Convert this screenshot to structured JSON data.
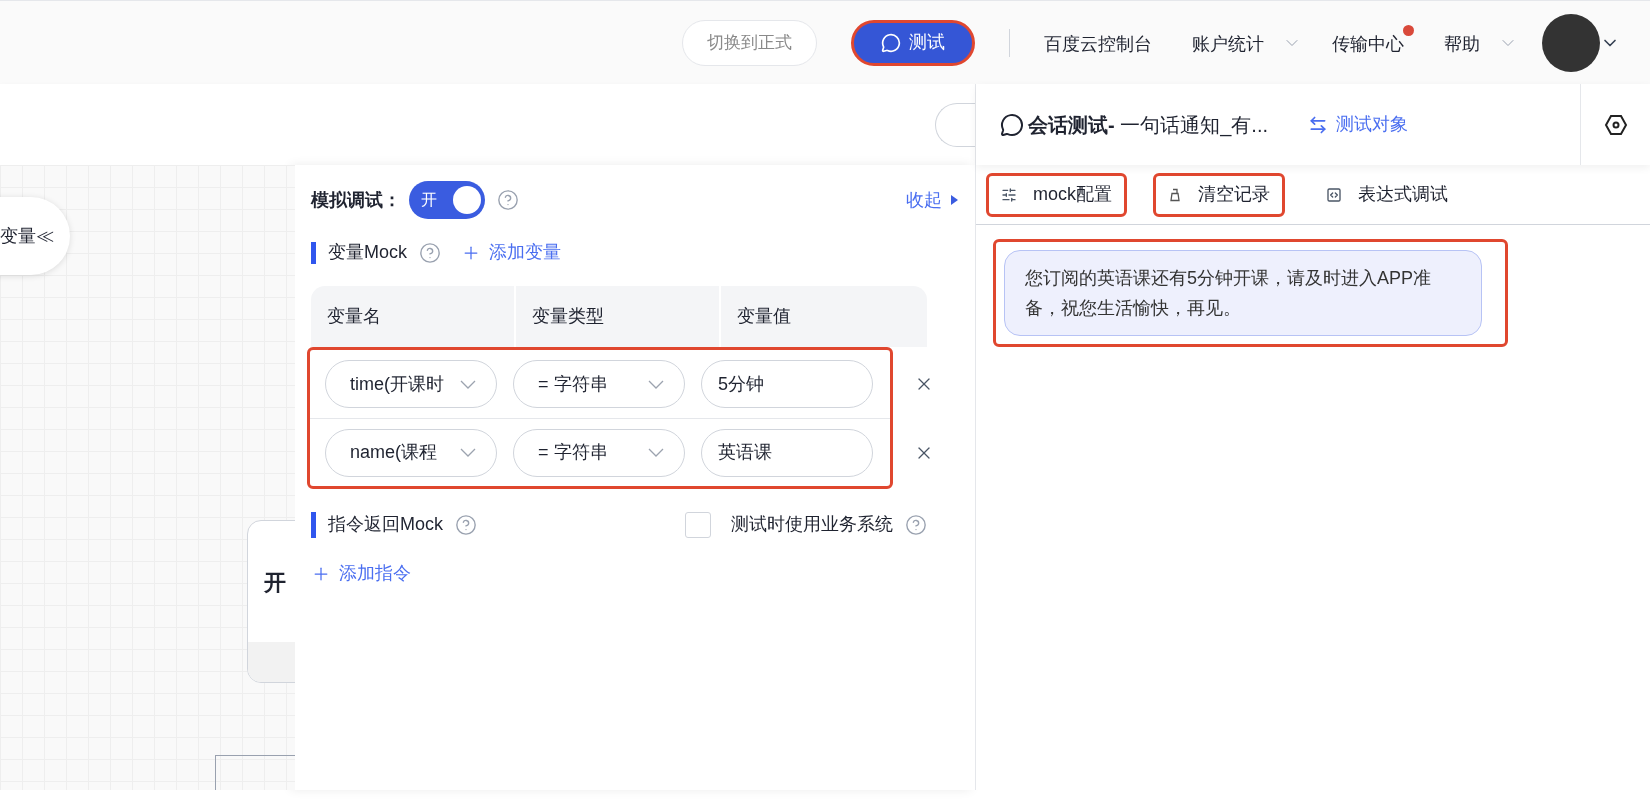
{
  "header": {
    "switch_button": "切换到正式",
    "test_button": {
      "label": "测试",
      "highlighted": true
    },
    "nav": [
      {
        "label": "百度云控制台",
        "dropdown": false,
        "notification": false
      },
      {
        "label": "账户统计",
        "dropdown": true,
        "notification": false
      },
      {
        "label": "传输中心",
        "dropdown": false,
        "notification": true
      },
      {
        "label": "帮助",
        "dropdown": true,
        "notification": false
      }
    ]
  },
  "canvas": {
    "side_tab": "变量≪",
    "node_title": "开"
  },
  "mock_panel": {
    "title": "模拟调试：",
    "toggle": {
      "label": "开",
      "on": true
    },
    "collapse": "收起",
    "variable_section": {
      "title": "变量Mock",
      "add": "添加变量"
    },
    "columns": [
      "变量名",
      "变量类型",
      "变量值"
    ],
    "rows_highlighted": true,
    "rows": [
      {
        "name": "time(开课时",
        "type": "= 字符串",
        "value": "5分钟"
      },
      {
        "name": "name(课程",
        "type": "= 字符串",
        "value": "英语课"
      }
    ],
    "command_section": {
      "title": "指令返回Mock",
      "add": "添加指令"
    },
    "use_business_system": {
      "label": "测试时使用业务系统",
      "checked": false
    }
  },
  "chat": {
    "title_bold": "会话测试-",
    "title_rest": " 一句话通知_有...",
    "target_link": "测试对象",
    "tools": [
      {
        "kind": "sliders",
        "label": "mock配置",
        "highlighted": true
      },
      {
        "kind": "clear",
        "label": "清空记录",
        "highlighted": true
      },
      {
        "kind": "code",
        "label": "表达式调试",
        "highlighted": false
      }
    ],
    "messages": [
      {
        "text": "您订阅的英语课还有5分钟开课，请及时进入APP准备，祝您生活愉快，再见。",
        "highlighted": true
      }
    ]
  }
}
